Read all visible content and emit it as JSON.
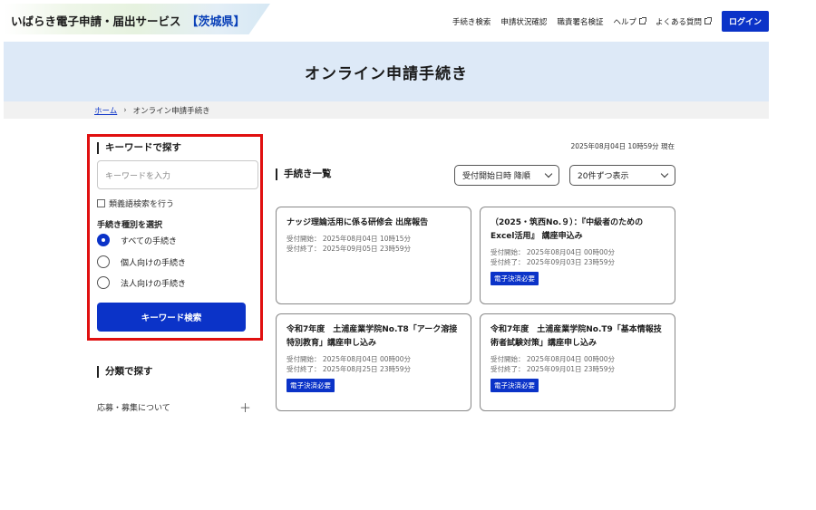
{
  "header": {
    "site_title": "いばらき電子申請・届出サービス",
    "prefecture": "【茨城県】",
    "nav": {
      "procedure_search": "手続き検索",
      "status_check": "申請状況確認",
      "signature_verify": "職責署名検証",
      "help": "ヘルプ",
      "faq": "よくある質問",
      "login": "ログイン"
    }
  },
  "banner": {
    "title": "オンライン申請手続き"
  },
  "breadcrumb": {
    "home": "ホーム",
    "separator": "›",
    "current": "オンライン申請手続き"
  },
  "sidebar": {
    "keyword_heading": "キーワードで探す",
    "keyword_placeholder": "キーワードを入力",
    "synonym_label": "類義語検索を行う",
    "type_label": "手続き種別を選択",
    "types": [
      {
        "label": "すべての手続き",
        "selected": true
      },
      {
        "label": "個人向けの手続き",
        "selected": false
      },
      {
        "label": "法人向けの手続き",
        "selected": false
      }
    ],
    "search_button": "キーワード検索",
    "category_heading": "分類で探す",
    "categories": [
      {
        "label": "応募・募集について",
        "expand": "＋"
      }
    ]
  },
  "main": {
    "timestamp": "2025年08月04日 10時59分 現在",
    "list_heading": "手続き一覧",
    "sort_select": "受付開始日時 降順",
    "per_page_select": "20件ずつ表示",
    "cards": [
      {
        "title": "ナッジ理論活用に係る研修会 出席報告",
        "start": "受付開始： 2025年08月04日 10時15分",
        "end": "受付終了： 2025年09月05日 23時59分",
        "badge": ""
      },
      {
        "title": "（2025・筑西No.９）：『中級者のためのExcel活用』 講座申込み",
        "start": "受付開始： 2025年08月04日 00時00分",
        "end": "受付終了： 2025年09月03日 23時59分",
        "badge": "電子決済必要"
      },
      {
        "title": "令和7年度　土浦産業学院No.T8「アーク溶接特別教育」講座申し込み",
        "start": "受付開始： 2025年08月04日 00時00分",
        "end": "受付終了： 2025年08月25日 23時59分",
        "badge": "電子決済必要"
      },
      {
        "title": "令和7年度　土浦産業学院No.T9「基本情報技術者試験対策」講座申し込み",
        "start": "受付開始： 2025年08月04日 00時00分",
        "end": "受付終了： 2025年09月01日 23時59分",
        "badge": "電子決済必要"
      }
    ]
  },
  "colors": {
    "accent": "#0b33c8",
    "highlight_border": "#e01010",
    "banner_bg": "#dde9f7"
  }
}
